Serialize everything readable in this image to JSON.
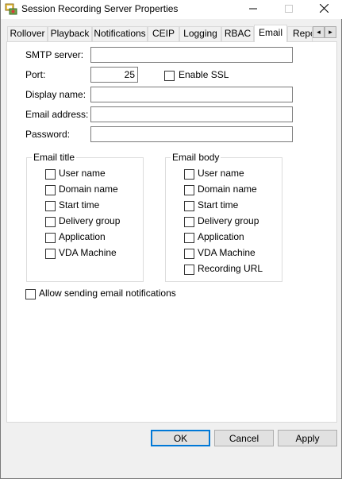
{
  "window": {
    "title": "Session Recording Server Properties",
    "icons": {
      "app": "recording-server-icon",
      "minimize": "minimize-icon",
      "maximize": "maximize-icon",
      "close": "close-icon"
    }
  },
  "tabs": [
    {
      "label": "Rollover",
      "active": false
    },
    {
      "label": "Playback",
      "active": false
    },
    {
      "label": "Notifications",
      "active": false
    },
    {
      "label": "CEIP",
      "active": false
    },
    {
      "label": "Logging",
      "active": false
    },
    {
      "label": "RBAC",
      "active": false
    },
    {
      "label": "Email",
      "active": true
    },
    {
      "label": "Repo",
      "active": false
    }
  ],
  "tab_scroll": {
    "left": "◂",
    "right": "▸"
  },
  "form": {
    "smtp_server": {
      "label": "SMTP server:",
      "value": ""
    },
    "port": {
      "label": "Port:",
      "value": "25"
    },
    "enable_ssl": {
      "label": "Enable SSL",
      "checked": false
    },
    "display_name": {
      "label": "Display name:",
      "value": ""
    },
    "email_address": {
      "label": "Email address:",
      "value": ""
    },
    "password": {
      "label": "Password:",
      "value": ""
    }
  },
  "email_title": {
    "label": "Email title",
    "items": [
      {
        "label": "User name",
        "checked": false
      },
      {
        "label": "Domain name",
        "checked": false
      },
      {
        "label": "Start time",
        "checked": false
      },
      {
        "label": "Delivery group",
        "checked": false
      },
      {
        "label": "Application",
        "checked": false
      },
      {
        "label": "VDA Machine",
        "checked": false
      }
    ]
  },
  "email_body": {
    "label": "Email body",
    "items": [
      {
        "label": "User name",
        "checked": false
      },
      {
        "label": "Domain name",
        "checked": false
      },
      {
        "label": "Start time",
        "checked": false
      },
      {
        "label": "Delivery group",
        "checked": false
      },
      {
        "label": "Application",
        "checked": false
      },
      {
        "label": "VDA Machine",
        "checked": false
      },
      {
        "label": "Recording URL",
        "checked": false
      }
    ]
  },
  "allow_notifications": {
    "label": "Allow sending email notifications",
    "checked": false
  },
  "buttons": {
    "ok": "OK",
    "cancel": "Cancel",
    "apply": "Apply"
  },
  "colors": {
    "accent": "#0078d7",
    "panel": "#ffffff",
    "window": "#f0f0f0"
  }
}
